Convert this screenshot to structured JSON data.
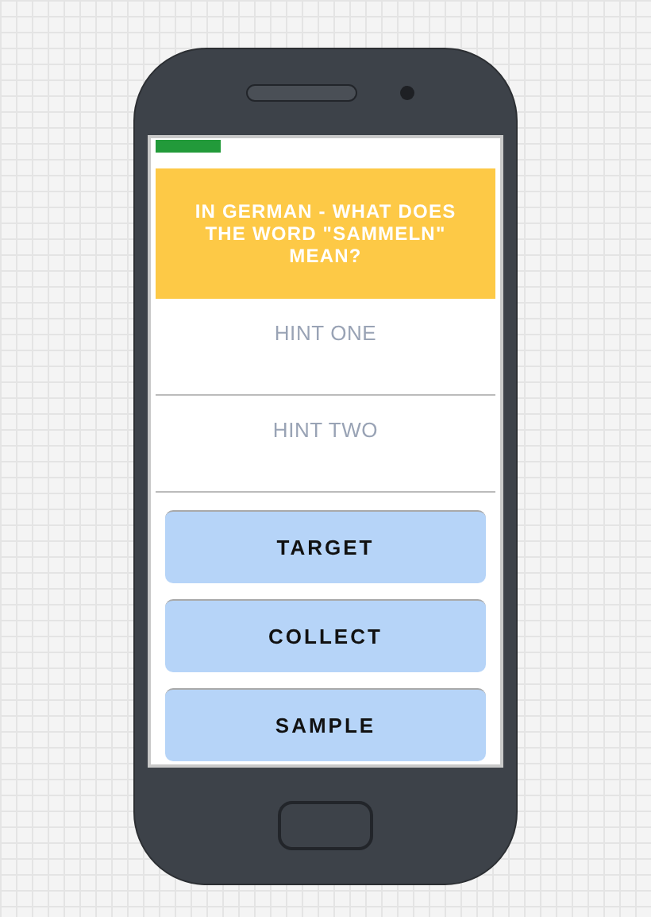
{
  "question": "IN GERMAN - WHAT DOES THE WORD \"SAMMELN\" MEAN?",
  "hints": [
    "HINT ONE",
    "HINT TWO"
  ],
  "answers": [
    "TARGET",
    "COLLECT",
    "SAMPLE"
  ]
}
